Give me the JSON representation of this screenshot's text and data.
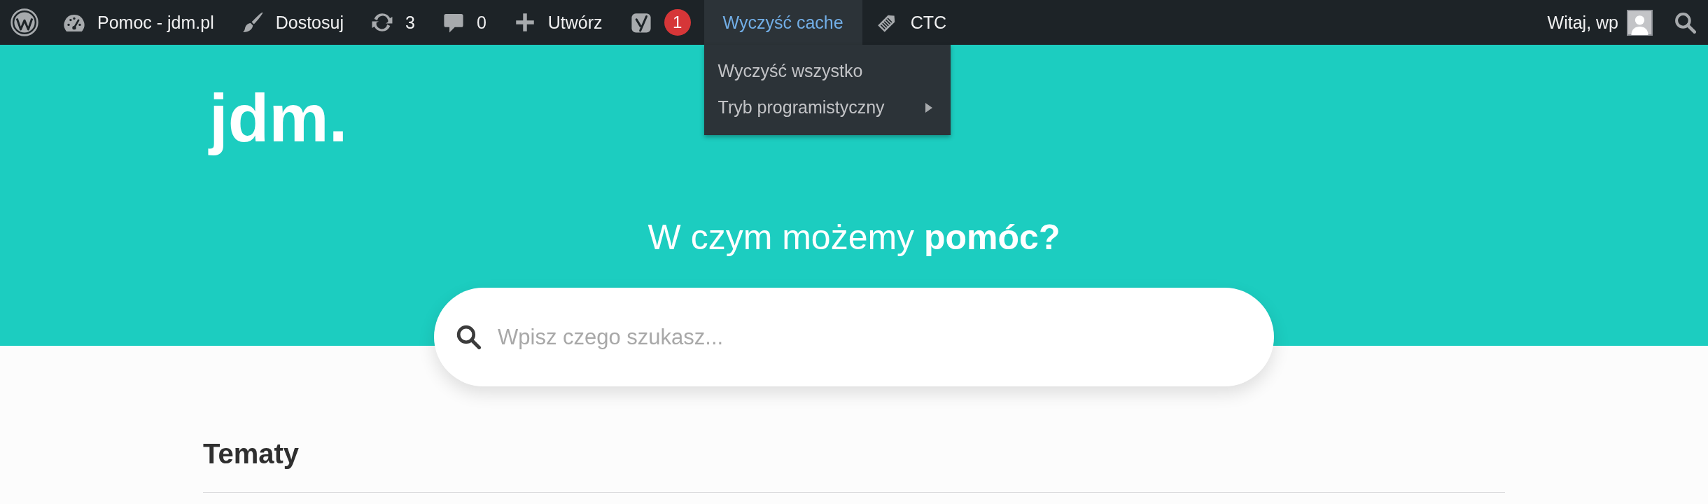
{
  "admin_bar": {
    "items": [
      {
        "kind": "logo",
        "expanded": false
      },
      {
        "kind": "site",
        "label": "Pomoc - jdm.pl",
        "expanded": false
      },
      {
        "kind": "customize",
        "label": "Dostosuj",
        "expanded": false
      },
      {
        "kind": "updates",
        "label": "3",
        "expanded": false
      },
      {
        "kind": "comments",
        "label": "0",
        "expanded": false
      },
      {
        "kind": "new",
        "label": "Utwórz",
        "expanded": false
      },
      {
        "kind": "seo",
        "badge": "1",
        "expanded": false
      },
      {
        "kind": "cache",
        "label": "Wyczyść cache",
        "expanded": true,
        "menu": [
          {
            "label": "Wyczyść wszystko",
            "has_submenu": false
          },
          {
            "label": "Tryb programistyczny",
            "has_submenu": true
          }
        ]
      },
      {
        "kind": "ctc",
        "label": "CTC",
        "expanded": false
      }
    ],
    "account": {
      "label": "Witaj, wp"
    }
  },
  "hero": {
    "logo": "jdm.",
    "heading": "W czym możemy **pomóc?**",
    "search": {
      "placeholder": "Wpisz czego szukasz..."
    }
  },
  "section": {
    "title": "Tematy"
  }
}
